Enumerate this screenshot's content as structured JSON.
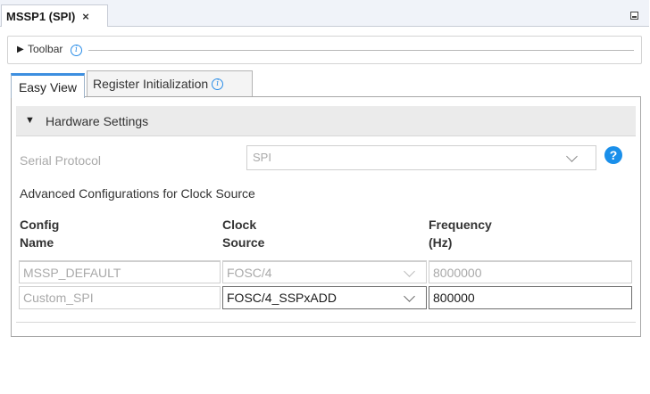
{
  "view_tab": {
    "title": "MSSP1 (SPI)",
    "close": "×"
  },
  "toolbar": {
    "label": "Toolbar",
    "info": "i"
  },
  "tabs": [
    {
      "label": "Easy View"
    },
    {
      "label": "Register Initialization",
      "info": "i"
    }
  ],
  "hardware": {
    "header": "Hardware Settings",
    "serial_protocol": {
      "label": "Serial Protocol",
      "value": "SPI"
    },
    "help": "?"
  },
  "advanced": {
    "title": "Advanced Configurations for Clock Source",
    "columns": [
      {
        "line1": "Config",
        "line2": "Name"
      },
      {
        "line1": "Clock",
        "line2": "Source"
      },
      {
        "line1": "Frequency",
        "line2": "(Hz)"
      }
    ],
    "rows": [
      {
        "name": "MSSP_DEFAULT",
        "clock": "FOSC/4",
        "freq": "8000000",
        "enabled": false
      },
      {
        "name": "Custom_SPI",
        "clock": "FOSC/4_SSPxADD",
        "freq": "800000",
        "enabled": true
      }
    ]
  },
  "colors": {
    "accent": "#3d8fe0",
    "help_bg": "#1a8fea",
    "disabled_text": "#a9a9a9"
  }
}
